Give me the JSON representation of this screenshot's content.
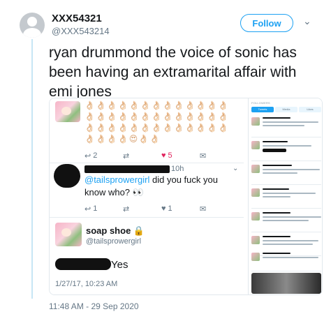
{
  "author": {
    "display_name": "XXX54321",
    "handle": "@XXX543214",
    "follow_label": "Follow",
    "caret": "⌄"
  },
  "tweet": {
    "text": "ryan drummond the voice of sonic has been having an extramarital affair with emi jones",
    "timestamp": "11:48 AM - 29 Sep 2020"
  },
  "media": {
    "left_screenshot": {
      "emoji_row": "👌🏻👌🏻👌🏻👌🏻👌🏻👌🏻👌🏻👌🏻👌🏻👌🏻👌🏻👌🏻👌🏻👌🏻👌🏻👌🏻👌🏻👌🏻👌🏻👌🏻👌🏻👌🏻👌🏻👌🏻👌🏻👌🏻👌🏻👌🏻👌🏻👌🏻👌🏻👌🏻👌🏻👌🏻👌🏻👌🏻👌🏻👌🏻👌🏻👌🏻👌🏻👌🏻👌🏻😍👌🏻👌🏻",
      "first_tweet_actions": {
        "reply_count": "2",
        "retweet_count": "",
        "like_count": "5"
      },
      "reply": {
        "time": "10h",
        "mention": "@tailsprowergirl",
        "text": " did you fuck you know who? 👀",
        "actions": {
          "reply_count": "1",
          "retweet_count": "",
          "like_count": "1"
        }
      },
      "response": {
        "name": "soap shoe 🔒",
        "handle": "@tailsprowergirl",
        "text": "Yes",
        "stamp": "1/27/17, 10:23 AM"
      }
    },
    "right_screenshot": {
      "header": "FOLLOWERS",
      "tabs": [
        "Tweets",
        "Media",
        "Likes"
      ]
    }
  },
  "colors": {
    "accent": "#1da1f2",
    "like": "#e0245e",
    "secondary_text": "#657786"
  }
}
